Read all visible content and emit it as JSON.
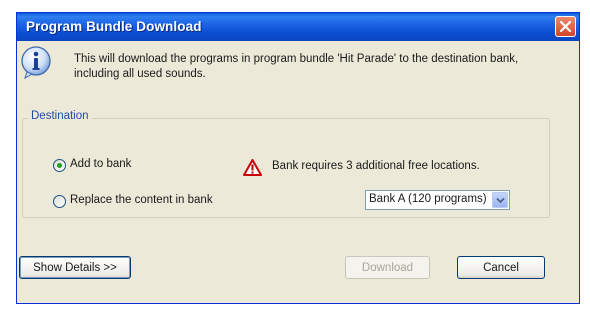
{
  "window": {
    "title": "Program Bundle Download"
  },
  "message": {
    "text": "This will download the programs in program bundle 'Hit Parade' to the destination bank, including all used sounds."
  },
  "destination": {
    "legend": "Destination",
    "options": [
      {
        "label": "Add to bank",
        "selected": true
      },
      {
        "label": "Replace the content in bank",
        "selected": false
      }
    ],
    "warning": "Bank requires 3 additional free locations.",
    "bank_select": {
      "value": "Bank A (120 programs)"
    }
  },
  "buttons": {
    "details": "Show Details >>",
    "download": "Download",
    "cancel": "Cancel"
  },
  "colors": {
    "title_bar": "#0c4fd2",
    "radio_dot": "#21a121",
    "warning": "#cc0000",
    "close_button": "#d4442a"
  },
  "icons": [
    "info-icon",
    "warning-icon",
    "close-icon",
    "chevron-down-icon"
  ]
}
